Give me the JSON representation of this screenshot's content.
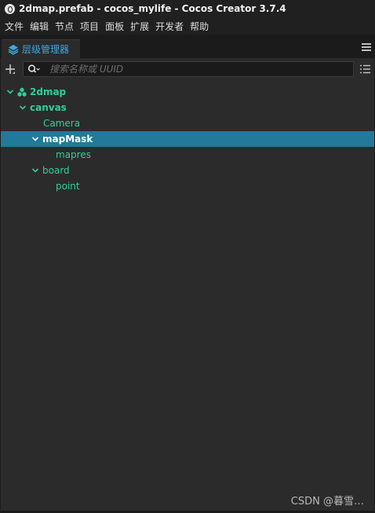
{
  "window": {
    "title": "2dmap.prefab - cocos_mylife - Cocos Creator 3.7.4"
  },
  "menu": [
    "文件",
    "编辑",
    "节点",
    "项目",
    "面板",
    "扩展",
    "开发者",
    "帮助"
  ],
  "panel": {
    "tab_label": "层级管理器",
    "tab_icon": "layers-icon",
    "search_placeholder": "搜索名称或 UUID",
    "search_value": ""
  },
  "tree": [
    {
      "label": "2dmap",
      "depth": 0,
      "expanded": true,
      "icon": "prefab-icon",
      "selected": false
    },
    {
      "label": "canvas",
      "depth": 1,
      "expanded": true,
      "selected": false
    },
    {
      "label": "Camera",
      "depth": 2,
      "leaf": true,
      "selected": false
    },
    {
      "label": "mapMask",
      "depth": 2,
      "expanded": true,
      "selected": true
    },
    {
      "label": "mapres",
      "depth": 3,
      "leaf": true,
      "selected": false
    },
    {
      "label": "board",
      "depth": 2,
      "expanded": true,
      "selected": false
    },
    {
      "label": "point",
      "depth": 3,
      "leaf": true,
      "selected": false
    }
  ],
  "watermark": "CSDN @暮雪…",
  "colors": {
    "node_text": "#2fd09a",
    "selected_row": "#217a99",
    "tab_accent": "#3fa8e0"
  }
}
